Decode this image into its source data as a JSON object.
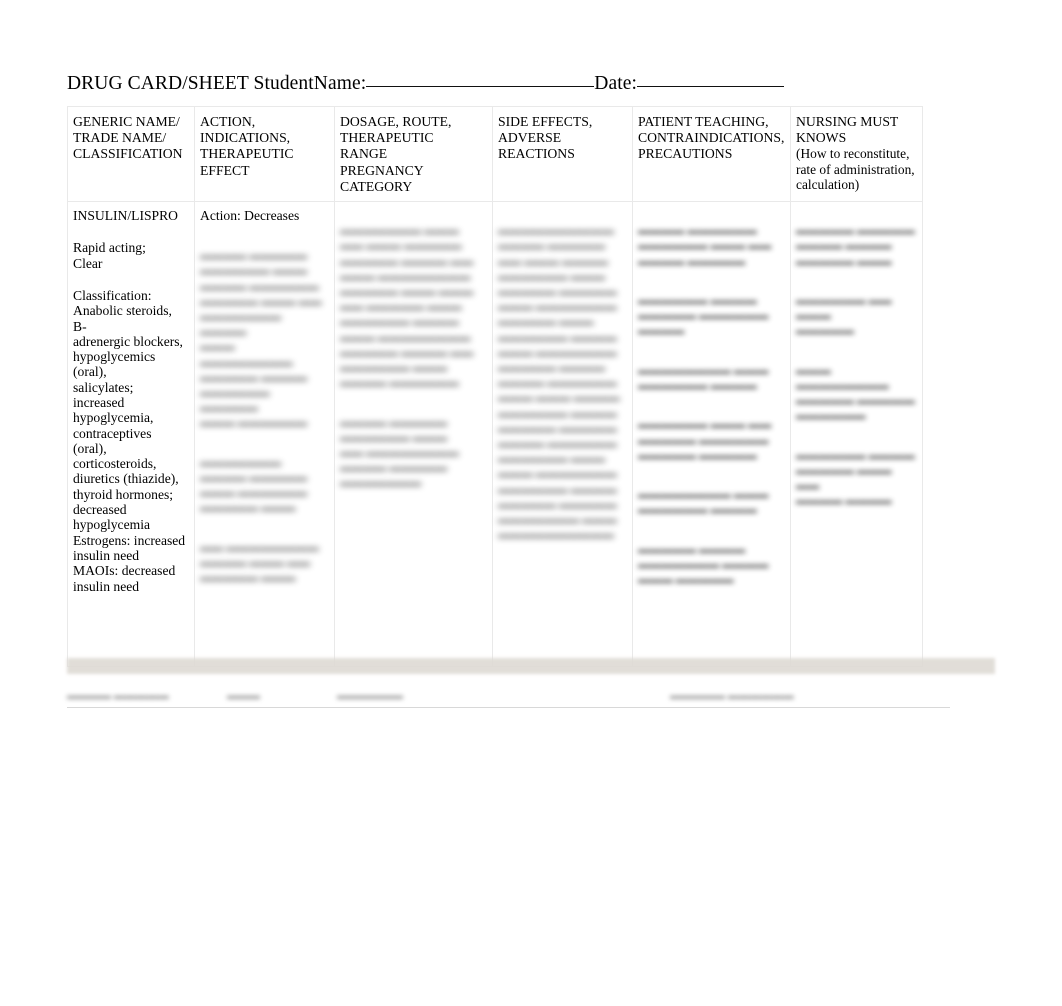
{
  "document": {
    "title_prefix": "DRUG CARD/SHEET StudentName:",
    "date_label": "Date:"
  },
  "table": {
    "headers": [
      "GENERIC NAME/\nTRADE NAME/\nCLASSIFICATION",
      "ACTION,\nINDICATIONS,\nTHERAPEUTIC\nEFFECT",
      "DOSAGE,  ROUTE,\nTHERAPEUTIC\nRANGE\nPREGNANCY\nCATEGORY",
      "SIDE EFFECTS,\nADVERSE\nREACTIONS",
      "PATIENT TEACHING,\nCONTRAINDICATIONS,\nPRECAUTIONS",
      "NURSING MUST\nKNOWS"
    ],
    "header_note_col6": "(How to reconstitute,\nrate of administration,\ncalculation)",
    "body": {
      "col1": {
        "drug_name": "INSULIN/LISPRO",
        "form": "Rapid acting;\nClear",
        "classification": "Classification:\nAnabolic steroids, B-\nadrenergic blockers,\nhypoglycemics (oral),\nsalicylates; increased\nhypoglycemia,\ncontraceptives (oral),\ncorticosteroids,\ndiuretics (thiazide),\nthyroid hormones;\ndecreased\nhypoglycemia\nEstrogens: increased\ninsulin need\nMAOIs: decreased\ninsulin need"
      },
      "col2": {
        "action_label": "Action:  Decreases",
        "redacted_1": "▬▬▬▬ ▬▬▬▬▬\n▬▬▬▬▬▬ ▬▬▬\n▬▬▬▬ ▬▬▬▬▬▬\n▬▬▬▬▬ ▬▬▬ ▬▬\n▬▬▬▬▬▬▬ ▬▬▬▬\n▬▬▬ ▬▬▬▬▬▬▬▬\n▬▬▬▬▬ ▬▬▬▬\n▬▬▬▬▬▬ ▬▬▬▬▬\n▬▬▬ ▬▬▬▬▬▬",
        "redacted_2": "▬▬▬▬▬▬▬\n▬▬▬▬ ▬▬▬▬▬\n▬▬▬ ▬▬▬▬▬▬\n▬▬▬▬▬ ▬▬▬",
        "redacted_3": "▬▬ ▬▬▬▬▬▬▬▬\n▬▬▬▬ ▬▬▬ ▬▬\n▬▬▬▬▬ ▬▬▬"
      },
      "col3": {
        "redacted_1": "▬▬▬▬▬▬▬ ▬▬▬\n▬▬ ▬▬▬ ▬▬▬▬▬\n▬▬▬▬▬ ▬▬▬▬ ▬▬\n▬▬▬ ▬▬▬▬▬▬▬▬\n▬▬▬▬▬ ▬▬▬ ▬▬▬\n▬▬ ▬▬▬▬▬ ▬▬▬\n▬▬▬▬▬▬ ▬▬▬▬\n▬▬▬ ▬▬▬▬▬▬▬▬\n▬▬▬▬▬ ▬▬▬▬ ▬▬\n▬▬▬▬▬▬ ▬▬▬\n▬▬▬▬ ▬▬▬▬▬▬",
        "redacted_2": "▬▬▬▬ ▬▬▬▬▬\n▬▬▬▬▬▬ ▬▬▬\n▬▬ ▬▬▬▬▬▬▬▬\n▬▬▬▬ ▬▬▬▬▬\n▬▬▬▬▬▬▬"
      },
      "col4": {
        "redacted_1": "▬▬▬▬▬▬▬▬▬▬\n▬▬▬▬ ▬▬▬▬▬\n▬▬ ▬▬▬ ▬▬▬▬\n▬▬▬▬▬▬ ▬▬▬\n▬▬▬▬▬ ▬▬▬▬▬\n▬▬▬ ▬▬▬▬▬▬▬\n▬▬▬▬▬ ▬▬▬\n▬▬▬▬▬▬ ▬▬▬▬\n▬▬▬ ▬▬▬▬▬▬▬\n▬▬▬▬▬ ▬▬▬▬\n▬▬▬▬ ▬▬▬▬▬▬\n▬▬▬ ▬▬▬ ▬▬▬▬\n▬▬▬▬▬▬ ▬▬▬▬\n▬▬▬▬▬ ▬▬▬▬▬\n▬▬▬▬ ▬▬▬▬▬▬\n▬▬▬▬▬▬ ▬▬▬\n▬▬▬ ▬▬▬▬▬▬▬\n▬▬▬▬▬▬ ▬▬▬▬\n▬▬▬▬▬ ▬▬▬▬▬\n▬▬▬▬▬▬▬ ▬▬▬\n▬▬▬▬▬▬▬▬▬▬"
      },
      "col5": {
        "redacted_1": "▬▬▬▬ ▬▬▬▬▬▬\n▬▬▬▬▬▬ ▬▬▬ ▬▬\n▬▬▬▬ ▬▬▬▬▬",
        "redacted_2": "▬▬▬▬▬▬ ▬▬▬▬\n▬▬▬▬▬ ▬▬▬▬▬▬\n▬▬▬▬",
        "redacted_3": "▬▬▬▬▬▬▬▬ ▬▬▬\n▬▬▬▬▬▬ ▬▬▬▬",
        "redacted_4": "▬▬▬▬▬▬ ▬▬▬ ▬▬\n▬▬▬▬▬ ▬▬▬▬▬▬\n▬▬▬▬▬ ▬▬▬▬▬",
        "redacted_5": "▬▬▬▬▬▬▬▬ ▬▬▬\n▬▬▬▬▬▬ ▬▬▬▬",
        "redacted_6": "▬▬▬▬▬ ▬▬▬▬\n▬▬▬▬▬▬▬ ▬▬▬▬\n▬▬▬ ▬▬▬▬▬"
      },
      "col6": {
        "redacted_1": "▬▬▬▬▬ ▬▬▬▬▬\n▬▬▬▬ ▬▬▬▬\n▬▬▬▬▬ ▬▬▬",
        "redacted_2": "▬▬▬▬▬▬ ▬▬ ▬▬▬\n▬▬▬▬▬",
        "redacted_3": "▬▬▬ ▬▬▬▬▬▬▬▬\n▬▬▬▬▬ ▬▬▬▬▬\n▬▬▬▬▬▬",
        "redacted_4": "▬▬▬▬▬▬ ▬▬▬▬\n▬▬▬▬▬ ▬▬▬ ▬▬\n▬▬▬▬ ▬▬▬▬"
      }
    }
  },
  "footer": {
    "item_1": "▬▬▬▬ ▬▬▬▬▬",
    "item_2": "▬▬▬",
    "item_3": "▬▬▬▬▬▬",
    "item_4": "▬▬▬▬▬ ▬▬▬▬▬▬"
  }
}
